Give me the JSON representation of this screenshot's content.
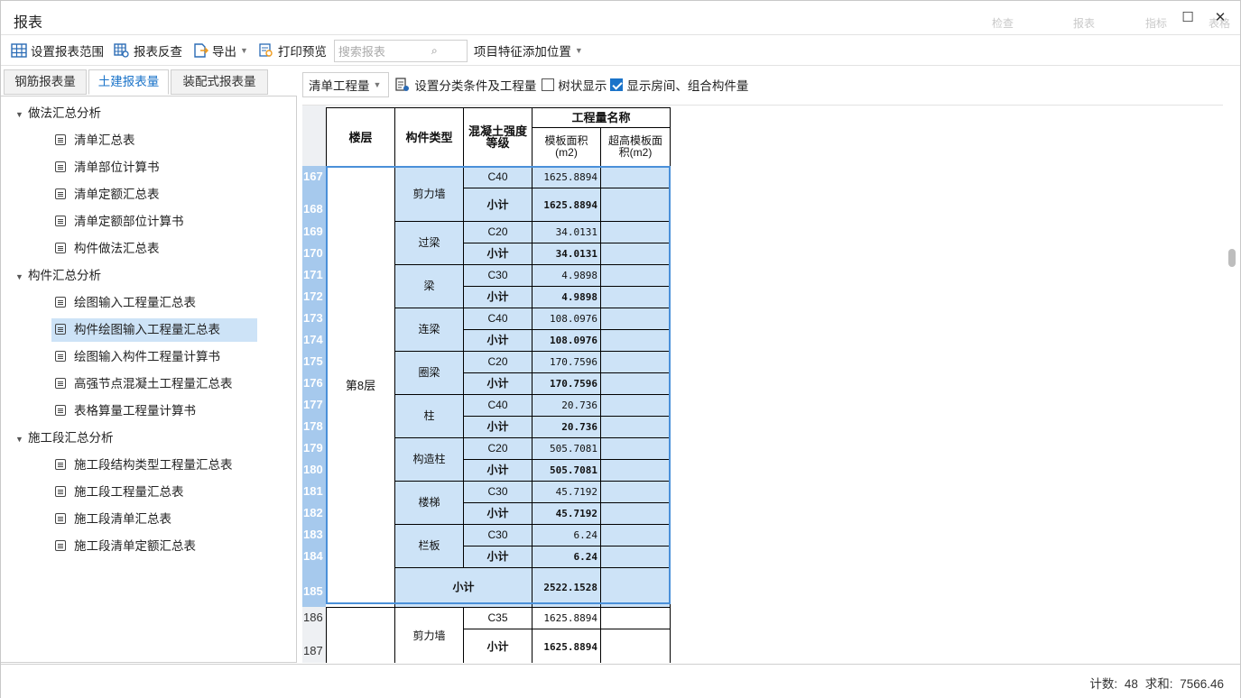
{
  "window": {
    "title": "报表",
    "ghost_items": [
      "检查",
      "报表",
      "指标",
      "表格"
    ]
  },
  "toolbar": {
    "set_range": "设置报表范围",
    "reverse_check": "报表反查",
    "export": "导出",
    "print_preview": "打印预览",
    "search_placeholder": "搜索报表",
    "feature_pos": "项目特征添加位置"
  },
  "tabs": [
    "钢筋报表量",
    "土建报表量",
    "装配式报表量"
  ],
  "tree": [
    {
      "group": "做法汇总分析",
      "items": [
        "清单汇总表",
        "清单部位计算书",
        "清单定额汇总表",
        "清单定额部位计算书",
        "构件做法汇总表"
      ]
    },
    {
      "group": "构件汇总分析",
      "items": [
        "绘图输入工程量汇总表",
        "构件绘图输入工程量汇总表",
        "绘图输入构件工程量计算书",
        "高强节点混凝土工程量汇总表",
        "表格算量工程量计算书"
      ]
    },
    {
      "group": "施工段汇总分析",
      "items": [
        "施工段结构类型工程量汇总表",
        "施工段工程量汇总表",
        "施工段清单汇总表",
        "施工段清单定额汇总表"
      ]
    }
  ],
  "selected_item": "构件绘图输入工程量汇总表",
  "right_toolbar": {
    "mode": "清单工程量",
    "set_cond": "设置分类条件及工程量",
    "tree_display": "树状显示",
    "tree_checked": false,
    "show_rooms": "显示房间、组合构件量",
    "rooms_checked": true
  },
  "table": {
    "headers": {
      "floor": "楼层",
      "type": "构件类型",
      "grade": "混凝土强度等级",
      "group": "工程量名称",
      "col1": "模板面积(m2)",
      "col2": "超高模板面积(m2)"
    },
    "floor": "第8层",
    "subtotal": "小计",
    "groups": [
      {
        "type": "剪力墙",
        "grade": "C40",
        "value": "1625.8894",
        "sub": "1625.8894"
      },
      {
        "type": "过梁",
        "grade": "C20",
        "value": "34.0131",
        "sub": "34.0131"
      },
      {
        "type": "梁",
        "grade": "C30",
        "value": "4.9898",
        "sub": "4.9898"
      },
      {
        "type": "连梁",
        "grade": "C40",
        "value": "108.0976",
        "sub": "108.0976"
      },
      {
        "type": "圈梁",
        "grade": "C20",
        "value": "170.7596",
        "sub": "170.7596"
      },
      {
        "type": "柱",
        "grade": "C40",
        "value": "20.736",
        "sub": "20.736"
      },
      {
        "type": "构造柱",
        "grade": "C20",
        "value": "505.7081",
        "sub": "505.7081"
      },
      {
        "type": "楼梯",
        "grade": "C30",
        "value": "45.7192",
        "sub": "45.7192"
      },
      {
        "type": "栏板",
        "grade": "C30",
        "value": "6.24",
        "sub": "6.24"
      }
    ],
    "floor_total": "2522.1528",
    "next": {
      "type": "剪力墙",
      "grade": "C35",
      "value": "1625.8894",
      "sub": "1625.8894"
    },
    "row_numbers": [
      "167",
      "168",
      "169",
      "170",
      "171",
      "172",
      "173",
      "174",
      "175",
      "176",
      "177",
      "178",
      "179",
      "180",
      "181",
      "182",
      "183",
      "184",
      "185",
      "186",
      "187"
    ]
  },
  "status": {
    "text": "计数: 48  求和: 7566.46"
  }
}
